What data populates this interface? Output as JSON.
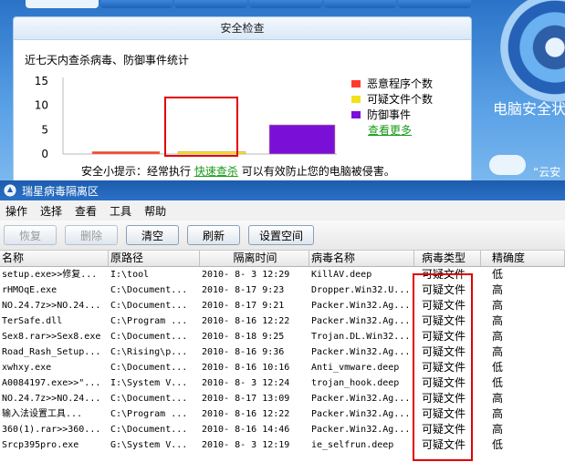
{
  "security_panel": {
    "header": "安全检查",
    "stats_title": "近七天内查杀病毒、防御事件统计",
    "tip_prefix": "安全小提示：经常执行",
    "tip_link": "快速查杀",
    "tip_suffix": "可以有效防止您的电脑被侵害。",
    "side_text": "电脑安全状",
    "side_text2": "“云安",
    "more_link": "查看更多"
  },
  "chart_data": {
    "type": "bar",
    "title": "近七天内查杀病毒、防御事件统计",
    "categories": [
      "恶意程序个数",
      "可疑文件个数",
      "防御事件"
    ],
    "values": [
      0.5,
      0.5,
      6
    ],
    "colors": [
      "#ff3b2f",
      "#f2e21c",
      "#7a10d8"
    ],
    "yticks": [
      0,
      5,
      10,
      15
    ],
    "ylim": [
      0,
      15
    ],
    "legend": [
      "恶意程序个数",
      "可疑文件个数",
      "防御事件"
    ],
    "legend_position": "right",
    "grid": false
  },
  "window": {
    "title": "瑞星病毒隔离区",
    "menu": [
      "操作",
      "选择",
      "查看",
      "工具",
      "帮助"
    ],
    "buttons": [
      {
        "label": "恢复",
        "enabled": false
      },
      {
        "label": "删除",
        "enabled": false
      },
      {
        "label": "清空",
        "enabled": true
      },
      {
        "label": "刷新",
        "enabled": true
      },
      {
        "label": "设置空间",
        "enabled": true
      }
    ],
    "columns": [
      "名称",
      "原路径",
      "隔离时间",
      "病毒名称",
      "病毒类型",
      "精确度"
    ],
    "rows": [
      [
        "setup.exe>>修复...",
        "I:\\tool",
        "2010- 8- 3 12:29",
        "KillAV.deep",
        "可疑文件",
        "低"
      ],
      [
        "rHMOqE.exe",
        "C:\\Document...",
        "2010- 8-17  9:23",
        "Dropper.Win32.U...",
        "可疑文件",
        "高"
      ],
      [
        "NO.24.7z>>NO.24...",
        "C:\\Document...",
        "2010- 8-17  9:21",
        "Packer.Win32.Ag...",
        "可疑文件",
        "高"
      ],
      [
        "TerSafe.dll",
        "C:\\Program ...",
        "2010- 8-16 12:22",
        "Packer.Win32.Ag...",
        "可疑文件",
        "高"
      ],
      [
        "Sex8.rar>>Sex8.exe",
        "C:\\Document...",
        "2010- 8-18  9:25",
        "Trojan.DL.Win32...",
        "可疑文件",
        "高"
      ],
      [
        "Road_Rash_Setup...",
        "C:\\Rising\\p...",
        "2010- 8-16  9:36",
        "Packer.Win32.Ag...",
        "可疑文件",
        "高"
      ],
      [
        "xwhxy.exe",
        "C:\\Document...",
        "2010- 8-16 10:16",
        "Anti_vmware.deep",
        "可疑文件",
        "低"
      ],
      [
        "A0084197.exe>>\"...",
        "I:\\System V...",
        "2010- 8- 3 12:24",
        "trojan_hook.deep",
        "可疑文件",
        "低"
      ],
      [
        "NO.24.7z>>NO.24...",
        "C:\\Document...",
        "2010- 8-17 13:09",
        "Packer.Win32.Ag...",
        "可疑文件",
        "高"
      ],
      [
        "输入法设置工具...",
        "C:\\Program ...",
        "2010- 8-16 12:22",
        "Packer.Win32.Ag...",
        "可疑文件",
        "高"
      ],
      [
        "360(1).rar>>360...",
        "C:\\Document...",
        "2010- 8-16 14:46",
        "Packer.Win32.Ag...",
        "可疑文件",
        "高"
      ],
      [
        "Srcp395pro.exe",
        "G:\\System V...",
        "2010- 8- 3 12:19",
        "ie_selfrun.deep",
        "可疑文件",
        "低"
      ]
    ]
  }
}
